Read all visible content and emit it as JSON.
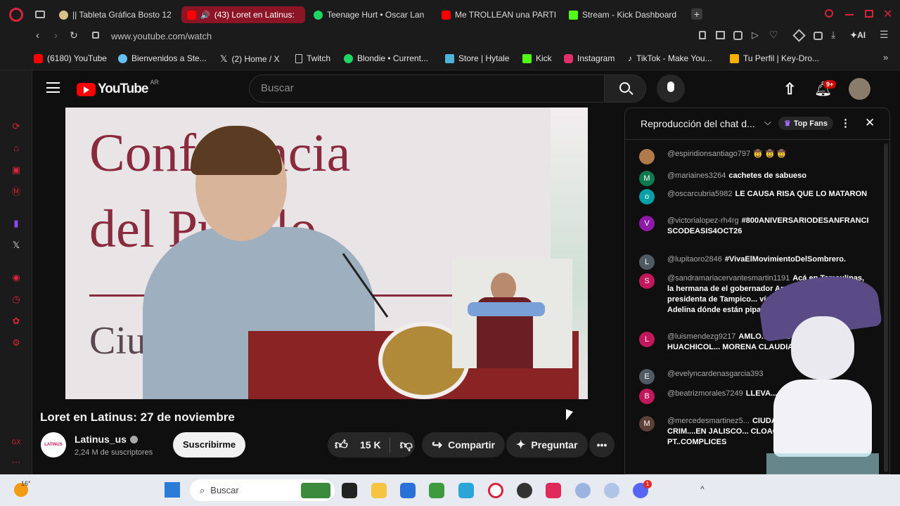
{
  "tabs": [
    {
      "label": "|| Tableta Gráfica Bosto 12",
      "icon": "bosto-favicon",
      "color": "#d9c28a",
      "active": false
    },
    {
      "label": "(43) Loret en Latinus:",
      "icon": "youtube-favicon",
      "color": "#ff0000",
      "active": true
    },
    {
      "label": "Teenage Hurt • Oscar Lan",
      "icon": "spotify-favicon",
      "color": "#1ed760",
      "active": false
    },
    {
      "label": "Me TROLLEAN una PARTI",
      "icon": "youtube-favicon",
      "color": "#ff0000",
      "active": false
    },
    {
      "label": "Stream - Kick Dashboard",
      "icon": "kick-favicon",
      "color": "#53fc18",
      "active": false
    }
  ],
  "address": {
    "url": "www.youtube.com/watch",
    "ai_label": "AI"
  },
  "bookmarks": [
    {
      "label": "(6180) YouTube",
      "icon": "youtube-icon",
      "color": "#ff0000"
    },
    {
      "label": "Bienvenidos a Ste...",
      "icon": "steam-icon",
      "color": "#66c0f4"
    },
    {
      "label": "(2) Home / X",
      "icon": "x-icon",
      "color": "#ffffff"
    },
    {
      "label": "Twitch",
      "icon": "page-icon",
      "color": "#cccccc"
    },
    {
      "label": "Blondie • Current...",
      "icon": "spotify-icon",
      "color": "#1ed760"
    },
    {
      "label": "Store | Hytale",
      "icon": "hytale-icon",
      "color": "#4fb3d9"
    },
    {
      "label": "Kick",
      "icon": "kick-icon",
      "color": "#53fc18"
    },
    {
      "label": "Instagram",
      "icon": "instagram-icon",
      "color": "#e1306c"
    },
    {
      "label": "TikTok - Make You...",
      "icon": "tiktok-icon",
      "color": "#ffffff"
    },
    {
      "label": "Tu Perfil | Key-Dro...",
      "icon": "keydrop-icon",
      "color": "#f5b000"
    }
  ],
  "youtube": {
    "logo_text": "YouTube",
    "region": "AR",
    "search_placeholder": "Buscar",
    "notification_count": "9+"
  },
  "video": {
    "banner_line1": "Conferencia",
    "banner_line2": "del Pueblo",
    "banner_line3": "Ciu",
    "title": "Loret en Latinus: 27 de noviembre",
    "channel_name": "Latinus_us",
    "channel_avatar": "LATINUS",
    "subscribers": "2,24 M de suscriptores",
    "subscribe_label": "Suscribirme",
    "likes": "15 K",
    "share_label": "Compartir",
    "ask_label": "Preguntar"
  },
  "chat": {
    "header": "Reproducción del chat d...",
    "top_fans": "Top Fans",
    "messages": [
      {
        "initial": "",
        "color": "#b07a4a",
        "user": "@espiridionsantiago797",
        "text": "🤠 🤠 🤠"
      },
      {
        "initial": "M",
        "color": "#0f7a4d",
        "user": "@mariaines3264",
        "text": "cachetes de sabueso"
      },
      {
        "initial": "o",
        "color": "#00a0a6",
        "user": "@oscarcubria5982",
        "text": "LE CAUSA RISA QUE LO MATARON"
      },
      {
        "initial": "V",
        "color": "#8e1aa8",
        "user": "@victorialopez-rh4rg",
        "text": "#800ANIVERSARIODESANFRANCISCODEASIS4OCT26"
      },
      {
        "initial": "L",
        "color": "#4f5a63",
        "user": "@lupitaoro2846",
        "text": "#VivaElMovimientoDelSombrero."
      },
      {
        "initial": "S",
        "color": "#c2185b",
        "user": "@sandramariacervantesmartin1191",
        "text": "Acá en Tamaulipas, la hermana de el gobernador Américo Villarreal, es presidenta de Tampico... vía ahí, acá en Altamira ah... Adelina dónde están pipas o..."
      },
      {
        "initial": "L",
        "color": "#c2185b",
        "user": "@luismendezg9217",
        "text": "AMLO... ESTE CARTEL DEL HUACHICOL... MORENA CLAUDIA SOLO LA..."
      },
      {
        "initial": "E",
        "color": "#4f5a63",
        "user": "@evelyncardenasgarcia393",
        "text": ""
      },
      {
        "initial": "B",
        "color": "#c2185b",
        "user": "@beatrizmorales7249",
        "text": "LLEVA... DE MERCH"
      },
      {
        "initial": "M",
        "color": "#5d4037",
        "user": "@mercedesmartinez5...",
        "text": "CIUDADANO ES COM... CRIM....EN JALISCO... CLOACA IMPRESIO... PT..COMPLICES"
      }
    ]
  },
  "taskbar": {
    "weather": "16°",
    "search_label": "Buscar",
    "discord_badge": "1"
  }
}
